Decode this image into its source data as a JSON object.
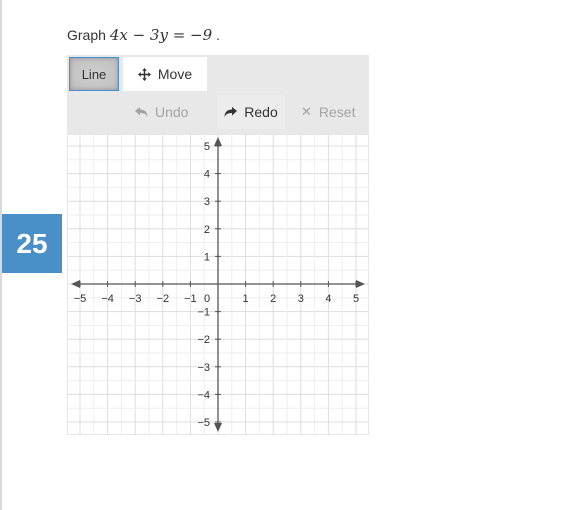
{
  "question": {
    "number": "25",
    "prefix": "Graph",
    "equation": "4x − 3y = −9",
    "suffix": "."
  },
  "toolbar": {
    "line_label": "Line",
    "move_label": "Move",
    "undo_label": "Undo",
    "redo_label": "Redo",
    "reset_label": "Reset"
  },
  "graph": {
    "x_range": [
      -5,
      5
    ],
    "y_range": [
      -5,
      5
    ],
    "x_ticks": [
      "−5",
      "−4",
      "−3",
      "−2",
      "−1",
      "0",
      "1",
      "2",
      "3",
      "4",
      "5"
    ],
    "y_ticks": [
      "5",
      "4",
      "3",
      "2",
      "1",
      "−1",
      "−2",
      "−3",
      "−4",
      "−5"
    ],
    "grid": true
  },
  "colors": {
    "question_badge": "#4a90c8",
    "selected_border": "#4a8fd4",
    "toolbar_bg": "#e8e8e8",
    "grid_line": "#dddddd",
    "axis": "#555555"
  }
}
